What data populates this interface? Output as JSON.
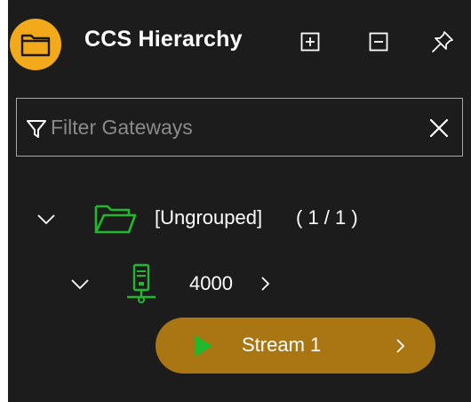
{
  "header": {
    "title": "CCS Hierarchy",
    "icons": [
      "folder-icon",
      "expand-all-icon",
      "collapse-all-icon",
      "pin-icon"
    ]
  },
  "filter": {
    "placeholder": "Filter Gateways",
    "value": ""
  },
  "tree": {
    "group": {
      "label": "[Ungrouped]",
      "count": "( 1 / 1 )",
      "expanded": true
    },
    "gateway": {
      "label": "4000",
      "expanded": true
    },
    "stream": {
      "label": "Stream 1"
    }
  },
  "colors": {
    "background": "#1c1c1c",
    "accent": "#f2a91a",
    "stream": "#aa7613",
    "green": "#22b82e"
  }
}
